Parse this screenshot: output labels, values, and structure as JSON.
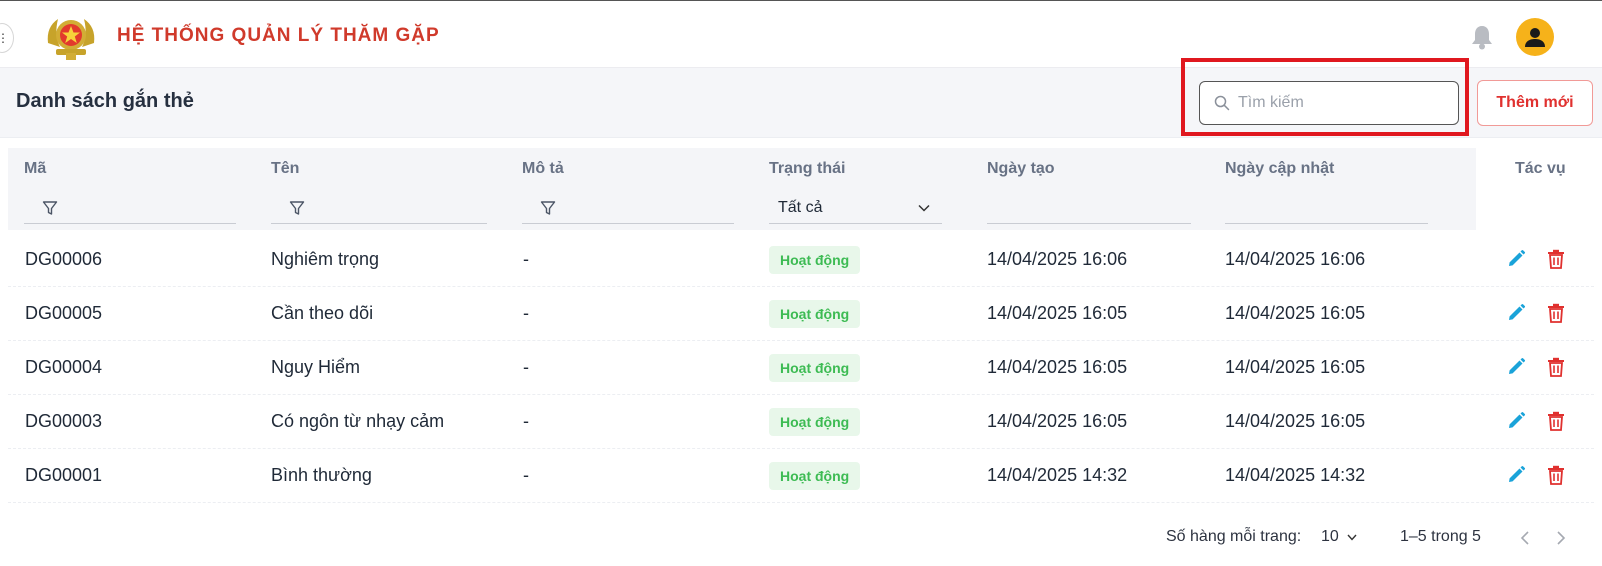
{
  "header": {
    "app_title": "HỆ THỐNG QUẢN LÝ THĂM GẶP",
    "logo_icon": "police-emblem-logo",
    "notification_icon": "bell-icon",
    "avatar_icon": "user-avatar-icon"
  },
  "toolbar": {
    "page_title": "Danh sách gắn thẻ",
    "search_placeholder": "Tìm kiếm",
    "add_label": "Thêm mới"
  },
  "table": {
    "columns": {
      "code": "Mã",
      "name": "Tên",
      "description": "Mô tả",
      "status": "Trạng thái",
      "created": "Ngày tạo",
      "updated": "Ngày cập nhật",
      "actions": "Tác vụ"
    },
    "status_filter_value": "Tất cả",
    "rows": [
      {
        "code": "DG00006",
        "name": "Nghiêm trọng",
        "description": "-",
        "status": "Hoạt động",
        "created": "14/04/2025 16:06",
        "updated": "14/04/2025 16:06"
      },
      {
        "code": "DG00005",
        "name": "Cần theo dõi",
        "description": "-",
        "status": "Hoạt động",
        "created": "14/04/2025 16:05",
        "updated": "14/04/2025 16:05"
      },
      {
        "code": "DG00004",
        "name": "Nguy Hiểm",
        "description": "-",
        "status": "Hoạt động",
        "created": "14/04/2025 16:05",
        "updated": "14/04/2025 16:05"
      },
      {
        "code": "DG00003",
        "name": "Có ngôn từ nhạy cảm",
        "description": "-",
        "status": "Hoạt động",
        "created": "14/04/2025 16:05",
        "updated": "14/04/2025 16:05"
      },
      {
        "code": "DG00001",
        "name": "Bình thường",
        "description": "-",
        "status": "Hoạt động",
        "created": "14/04/2025 14:32",
        "updated": "14/04/2025 14:32"
      }
    ]
  },
  "pagination": {
    "rows_per_page_label": "Số hàng mỗi trang:",
    "rows_per_page_value": "10",
    "range_label": "1–5 trong 5"
  },
  "colors": {
    "brand_red": "#d03a2b",
    "active_badge_bg": "#e8f7ea",
    "active_badge_text": "#3dbb53",
    "edit_icon": "#1aa3d9",
    "delete_icon": "#e0312f",
    "avatar_bg": "#f6b21a",
    "highlight_border": "#e0181f"
  }
}
